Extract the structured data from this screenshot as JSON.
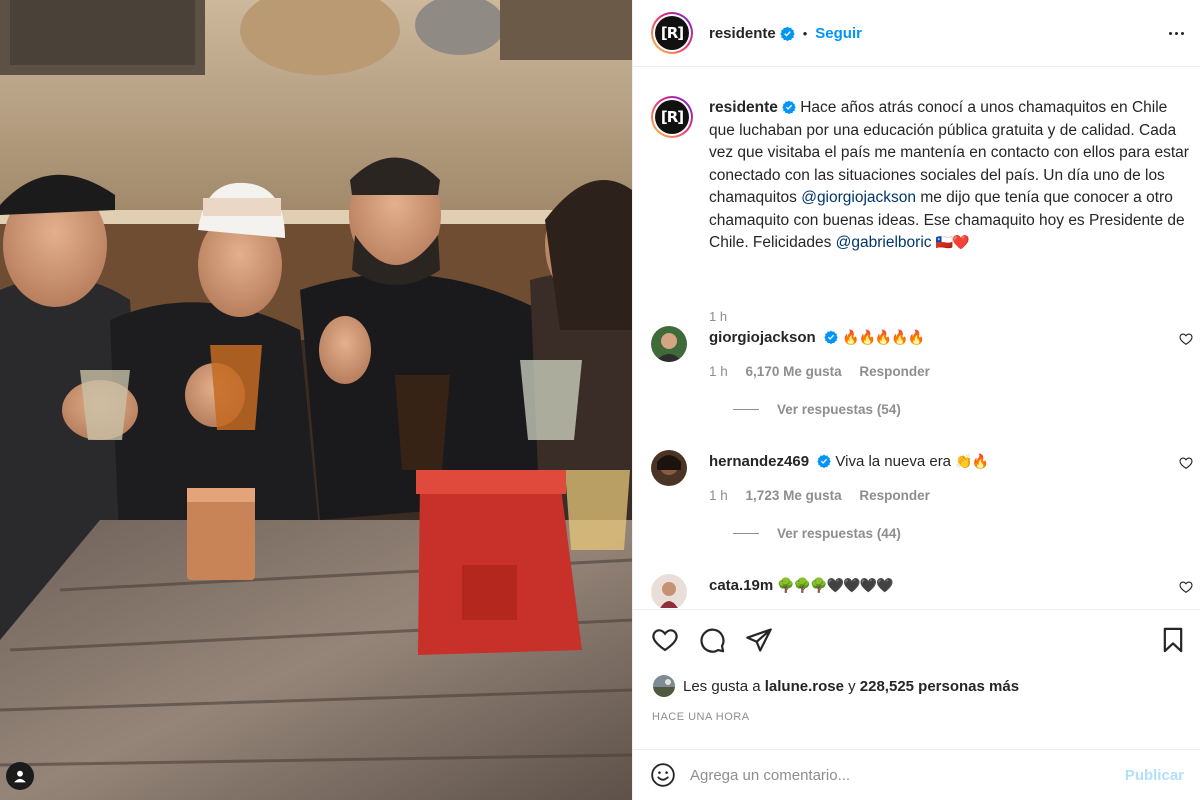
{
  "post": {
    "username": "residente",
    "avatar_text": "[R]",
    "follow_label": "Seguir",
    "dot": "•",
    "caption": {
      "part1": "Hace años atrás conocí a unos chamaquitos en Chile que luchaban por una educación pública gratuita y de calidad. Cada vez que visitaba el país me mantenía en contacto con ellos para estar conectado con las situaciones sociales del país. Un día uno de los chamaquitos ",
      "mention1": "@giorgiojackson",
      "part2": " me dijo que tenía que conocer a otro chamaquito con buenas ideas. Ese chamaquito hoy es Presidente de Chile. Felicidades ",
      "mention2": "@gabrielboric",
      "emoji": "🇨🇱❤️"
    },
    "caption_time": "1 h"
  },
  "comments": [
    {
      "user": "giorgiojackson",
      "text": "🔥🔥🔥🔥🔥",
      "time": "1 h",
      "likes": "6,170 Me gusta",
      "reply": "Responder",
      "view_replies": "Ver respuestas (54)"
    },
    {
      "user": "hernandez469",
      "text": "Viva la nueva era",
      "emoji": "👏🔥",
      "time": "1 h",
      "likes": "1,723 Me gusta",
      "reply": "Responder",
      "view_replies": "Ver respuestas (44)"
    },
    {
      "user": "cata.19m",
      "text": "🌳🌳🌳🖤🖤🖤🖤"
    }
  ],
  "likes_summary": {
    "prefix": "Les gusta a",
    "user": "lalune.rose",
    "connector": "y",
    "rest": "228,525 personas más"
  },
  "posted_ago": "HACE UNA HORA",
  "add_comment": {
    "placeholder": "Agrega un comentario...",
    "publish_label": "Publicar"
  },
  "colors": {
    "link_blue": "#0095f6",
    "mention": "#00376b",
    "muted": "#8e8e8e",
    "publish_disabled": "#b2dffc"
  }
}
